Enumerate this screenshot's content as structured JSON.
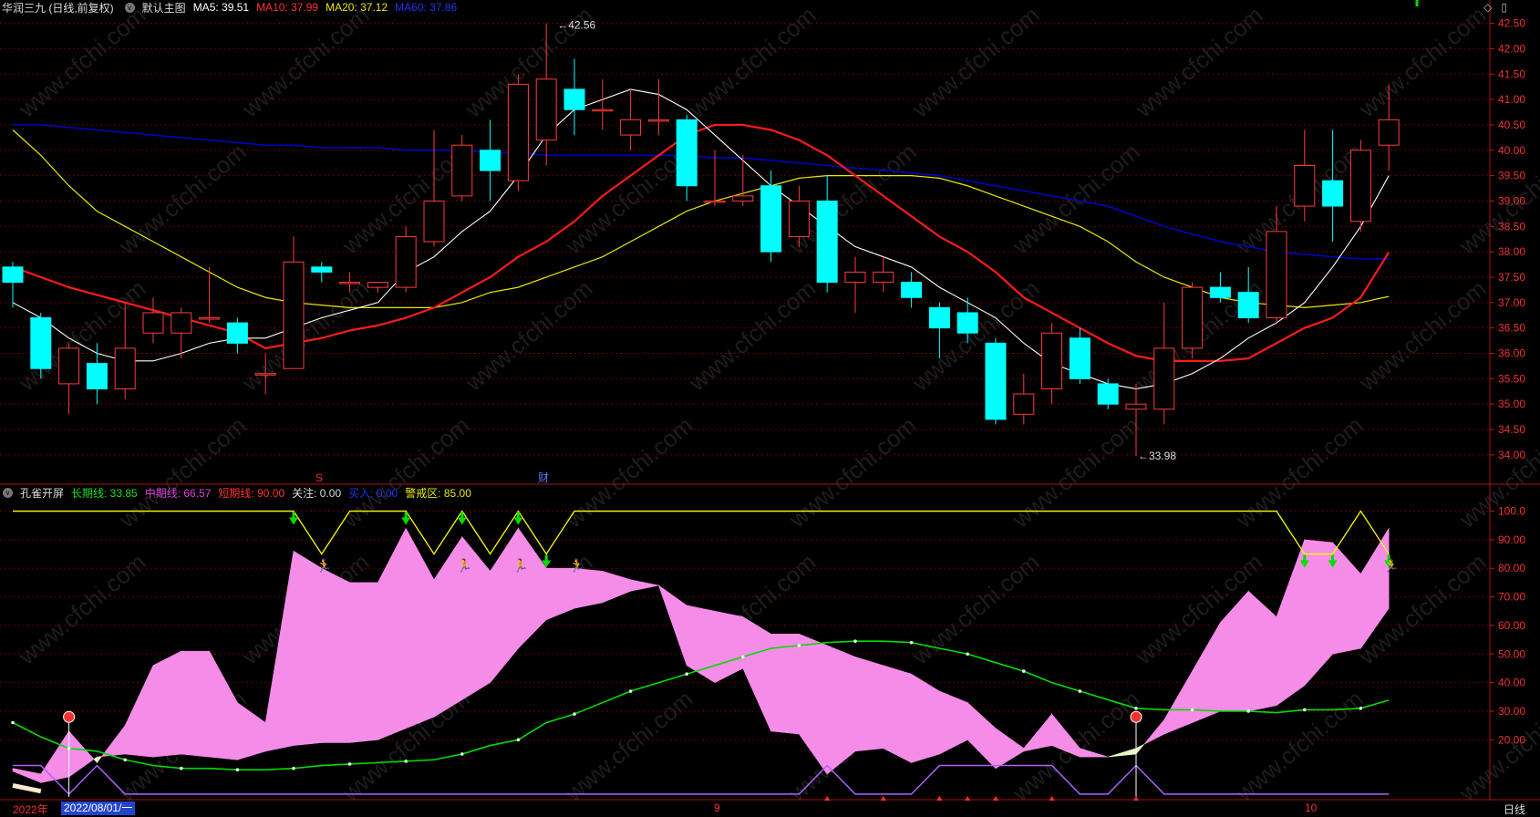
{
  "top_header": {
    "stock": "华润三九 (日线,前复权)",
    "chart_name": "默认主图",
    "ma5": "MA5: 39.51",
    "ma10": "MA10: 37.99",
    "ma20": "MA20: 37.12",
    "ma60": "MA60: 37.86"
  },
  "bottom_header": {
    "indicator": "孔雀开屏",
    "long": "长期线: 33.85",
    "mid": "中期线: 66.57",
    "short": "短期线: 90.00",
    "focus": "关注: 0.00",
    "buy": "买入: 0.00",
    "warn": "警戒区: 85.00"
  },
  "footer": {
    "year": "2022年",
    "date": "2022/08/01/一",
    "month9": "9",
    "month10": "10",
    "period": "日线"
  },
  "colors": {
    "up": "#ff3b3b",
    "down": "#00ffff",
    "ma5": "#ffffff",
    "ma10": "#ff1a1a",
    "ma20": "#e8e800",
    "ma60": "#0000cc",
    "long": "#00dd00",
    "pink": "#f58ce8",
    "cream": "#eaf7c4",
    "warn": "#ffff00",
    "purple": "#b060ff"
  },
  "chart_data": [
    {
      "type": "candlestick",
      "ylim": [
        33.8,
        42.6
      ],
      "yticks": [
        "42.50",
        "42.00",
        "41.50",
        "41.00",
        "40.50",
        "40.00",
        "39.50",
        "39.00",
        "38.50",
        "38.00",
        "37.50",
        "37.00",
        "36.50",
        "36.00",
        "35.50",
        "35.00",
        "34.50",
        "34.00"
      ],
      "candles": [
        {
          "o": 37.7,
          "c": 37.4,
          "h": 37.8,
          "l": 36.9
        },
        {
          "o": 36.7,
          "c": 35.7,
          "h": 36.8,
          "l": 35.5
        },
        {
          "o": 35.4,
          "c": 36.1,
          "h": 36.2,
          "l": 34.8
        },
        {
          "o": 35.8,
          "c": 35.3,
          "h": 36.2,
          "l": 35.0
        },
        {
          "o": 35.3,
          "c": 36.1,
          "h": 37.0,
          "l": 35.1
        },
        {
          "o": 36.4,
          "c": 36.8,
          "h": 37.1,
          "l": 36.2
        },
        {
          "o": 36.4,
          "c": 36.8,
          "h": 36.9,
          "l": 35.9
        },
        {
          "o": 36.7,
          "c": 36.7,
          "h": 37.7,
          "l": 36.6
        },
        {
          "o": 36.6,
          "c": 36.2,
          "h": 36.7,
          "l": 36.0
        },
        {
          "o": 35.6,
          "c": 35.6,
          "h": 36.0,
          "l": 35.2
        },
        {
          "o": 35.7,
          "c": 37.8,
          "h": 38.3,
          "l": 35.7
        },
        {
          "o": 37.7,
          "c": 37.6,
          "h": 37.8,
          "l": 37.4
        },
        {
          "o": 37.4,
          "c": 37.4,
          "h": 37.6,
          "l": 37.2
        },
        {
          "o": 37.3,
          "c": 37.4,
          "h": 37.4,
          "l": 37.2
        },
        {
          "o": 37.3,
          "c": 38.3,
          "h": 38.5,
          "l": 37.2
        },
        {
          "o": 38.2,
          "c": 39.0,
          "h": 40.4,
          "l": 38.1
        },
        {
          "o": 39.1,
          "c": 40.1,
          "h": 40.3,
          "l": 39.0
        },
        {
          "o": 40.0,
          "c": 39.6,
          "h": 40.6,
          "l": 39.0
        },
        {
          "o": 39.4,
          "c": 41.3,
          "h": 41.5,
          "l": 39.2
        },
        {
          "o": 40.2,
          "c": 41.4,
          "h": 42.5,
          "l": 39.7
        },
        {
          "o": 41.2,
          "c": 40.8,
          "h": 41.8,
          "l": 40.3
        },
        {
          "o": 40.8,
          "c": 40.8,
          "h": 41.4,
          "l": 40.4
        },
        {
          "o": 40.3,
          "c": 40.6,
          "h": 41.2,
          "l": 40.0
        },
        {
          "o": 40.6,
          "c": 40.6,
          "h": 41.4,
          "l": 40.3
        },
        {
          "o": 40.6,
          "c": 39.3,
          "h": 40.7,
          "l": 39.0
        },
        {
          "o": 39.0,
          "c": 39.0,
          "h": 40.0,
          "l": 38.9
        },
        {
          "o": 39.0,
          "c": 39.1,
          "h": 39.9,
          "l": 38.9
        },
        {
          "o": 39.3,
          "c": 38.0,
          "h": 39.6,
          "l": 37.8
        },
        {
          "o": 38.3,
          "c": 39.0,
          "h": 39.3,
          "l": 38.1
        },
        {
          "o": 39.0,
          "c": 37.4,
          "h": 39.5,
          "l": 37.2
        },
        {
          "o": 37.4,
          "c": 37.6,
          "h": 37.9,
          "l": 36.8
        },
        {
          "o": 37.4,
          "c": 37.6,
          "h": 37.9,
          "l": 37.2
        },
        {
          "o": 37.4,
          "c": 37.1,
          "h": 37.6,
          "l": 36.9
        },
        {
          "o": 36.9,
          "c": 36.5,
          "h": 37.0,
          "l": 35.9
        },
        {
          "o": 36.8,
          "c": 36.4,
          "h": 37.1,
          "l": 36.2
        },
        {
          "o": 36.2,
          "c": 34.7,
          "h": 36.3,
          "l": 34.6
        },
        {
          "o": 34.8,
          "c": 35.2,
          "h": 35.6,
          "l": 34.6
        },
        {
          "o": 35.3,
          "c": 36.4,
          "h": 36.6,
          "l": 35.0
        },
        {
          "o": 36.3,
          "c": 35.5,
          "h": 36.5,
          "l": 35.4
        },
        {
          "o": 35.4,
          "c": 35.0,
          "h": 35.5,
          "l": 34.9
        },
        {
          "o": 34.9,
          "c": 35.0,
          "h": 35.4,
          "l": 33.98
        },
        {
          "o": 34.9,
          "c": 36.1,
          "h": 37.0,
          "l": 34.6
        },
        {
          "o": 36.1,
          "c": 37.3,
          "h": 37.4,
          "l": 35.9
        },
        {
          "o": 37.3,
          "c": 37.1,
          "h": 37.6,
          "l": 37.0
        },
        {
          "o": 37.2,
          "c": 36.7,
          "h": 37.7,
          "l": 36.6
        },
        {
          "o": 36.7,
          "c": 38.4,
          "h": 38.9,
          "l": 36.6
        },
        {
          "o": 38.9,
          "c": 39.7,
          "h": 40.4,
          "l": 38.6
        },
        {
          "o": 39.4,
          "c": 38.9,
          "h": 40.4,
          "l": 38.2
        },
        {
          "o": 38.6,
          "c": 40.0,
          "h": 40.2,
          "l": 38.4
        },
        {
          "o": 40.1,
          "c": 40.6,
          "h": 41.3,
          "l": 39.6
        }
      ],
      "ma5": [
        37.0,
        36.7,
        36.3,
        36.0,
        35.85,
        35.85,
        36.0,
        36.2,
        36.3,
        36.3,
        36.5,
        36.7,
        36.85,
        37.0,
        37.6,
        37.9,
        38.4,
        38.8,
        39.5,
        40.3,
        40.8,
        41.0,
        41.2,
        41.1,
        40.8,
        40.3,
        39.8,
        39.3,
        38.9,
        38.5,
        38.1,
        37.9,
        37.7,
        37.3,
        37.0,
        36.7,
        36.2,
        35.8,
        35.6,
        35.4,
        35.3,
        35.4,
        35.6,
        35.9,
        36.3,
        36.6,
        37.0,
        37.7,
        38.5,
        39.5
      ],
      "ma10": [
        37.7,
        37.5,
        37.3,
        37.15,
        37.0,
        36.85,
        36.7,
        36.55,
        36.4,
        36.1,
        36.2,
        36.3,
        36.45,
        36.55,
        36.7,
        36.9,
        37.2,
        37.5,
        37.9,
        38.2,
        38.6,
        39.1,
        39.5,
        39.9,
        40.3,
        40.5,
        40.5,
        40.4,
        40.2,
        39.9,
        39.5,
        39.1,
        38.7,
        38.3,
        38.0,
        37.6,
        37.1,
        36.8,
        36.5,
        36.2,
        35.95,
        35.85,
        35.85,
        35.85,
        35.9,
        36.2,
        36.5,
        36.7,
        37.1,
        37.99
      ],
      "ma20": [
        40.4,
        39.9,
        39.3,
        38.8,
        38.5,
        38.2,
        37.9,
        37.6,
        37.3,
        37.1,
        37.0,
        36.95,
        36.9,
        36.9,
        36.9,
        36.9,
        37.0,
        37.2,
        37.3,
        37.5,
        37.7,
        37.9,
        38.2,
        38.5,
        38.8,
        39.0,
        39.15,
        39.3,
        39.45,
        39.5,
        39.5,
        39.5,
        39.5,
        39.45,
        39.3,
        39.1,
        38.9,
        38.7,
        38.5,
        38.2,
        37.8,
        37.5,
        37.3,
        37.1,
        37.0,
        36.95,
        36.9,
        36.95,
        37.0,
        37.12
      ],
      "ma60": [
        40.5,
        40.5,
        40.45,
        40.4,
        40.35,
        40.3,
        40.25,
        40.2,
        40.15,
        40.1,
        40.1,
        40.05,
        40.05,
        40.05,
        40.0,
        40.0,
        40.0,
        39.95,
        39.95,
        39.9,
        39.9,
        39.9,
        39.9,
        39.9,
        39.9,
        39.85,
        39.85,
        39.8,
        39.75,
        39.7,
        39.65,
        39.6,
        39.55,
        39.5,
        39.4,
        39.3,
        39.2,
        39.1,
        39.0,
        38.9,
        38.7,
        38.5,
        38.35,
        38.2,
        38.1,
        38.0,
        37.95,
        37.9,
        37.86,
        37.86
      ],
      "annotations": {
        "high": "42.56",
        "low": "33.98",
        "s": "S",
        "cai": "财"
      }
    },
    {
      "type": "area",
      "yticks": [
        "100.0",
        "90.00",
        "80.00",
        "70.00",
        "60.00",
        "50.00",
        "40.00",
        "30.00",
        "20.00"
      ],
      "ylim": [
        0,
        104
      ],
      "upper": [
        10,
        8,
        23,
        12,
        25,
        46,
        51,
        51,
        33,
        26,
        86,
        80,
        75,
        75,
        94,
        76,
        91,
        79,
        94,
        80,
        80,
        79,
        76,
        74,
        67,
        65,
        63,
        57,
        57,
        53,
        49,
        46,
        43,
        37,
        33,
        24,
        17,
        29,
        17,
        14,
        15,
        27,
        44,
        61,
        72,
        63,
        90,
        89,
        78,
        94
      ],
      "lower": [
        9,
        5,
        7,
        14,
        15,
        14,
        15,
        14,
        13,
        16,
        18,
        19,
        19,
        20,
        24,
        28,
        34,
        40,
        52,
        62,
        66,
        68,
        72,
        74,
        46,
        40,
        45,
        23,
        22,
        8,
        16,
        17,
        12,
        15,
        20,
        10,
        16,
        18,
        14,
        14,
        17,
        22,
        26,
        30,
        30,
        32,
        39,
        50,
        52,
        66
      ],
      "long_line": [
        26,
        21,
        17,
        16,
        13,
        11,
        10,
        10,
        9.5,
        9.5,
        10,
        11,
        11.5,
        12,
        12.5,
        13,
        15,
        18,
        20,
        26,
        29,
        33,
        37,
        40,
        43,
        46,
        49,
        52,
        53,
        54,
        54.5,
        54.5,
        54,
        52,
        50,
        47,
        44,
        40,
        37,
        34,
        31,
        30.5,
        30.5,
        30,
        30,
        29.5,
        30.5,
        30.5,
        31,
        33.85
      ],
      "short_line": [
        100,
        100,
        100,
        100,
        100,
        100,
        100,
        100,
        100,
        100,
        100,
        85,
        100,
        100,
        100,
        85,
        100,
        85,
        100,
        85,
        100,
        100,
        100,
        100,
        100,
        100,
        100,
        100,
        100,
        100,
        100,
        100,
        100,
        100,
        100,
        100,
        100,
        100,
        100,
        100,
        100,
        100,
        100,
        100,
        100,
        100,
        85,
        85,
        100,
        85
      ],
      "warn_level": 85,
      "purple": [
        10,
        10,
        0,
        10,
        0,
        0,
        0,
        0,
        0,
        0,
        0,
        0,
        0,
        0,
        0,
        0,
        0,
        0,
        0,
        0,
        0,
        0,
        0,
        0,
        0,
        0,
        0,
        0,
        0,
        10,
        0,
        0,
        0,
        10,
        10,
        10,
        10,
        10,
        0,
        0,
        10,
        0,
        0,
        0,
        0,
        0,
        0,
        0,
        0,
        0
      ],
      "arrows": [
        10,
        14,
        16,
        18,
        19,
        46,
        47,
        49,
        50
      ],
      "runners": [
        11,
        16,
        18,
        20,
        49
      ],
      "markers": [
        2,
        40
      ]
    }
  ]
}
